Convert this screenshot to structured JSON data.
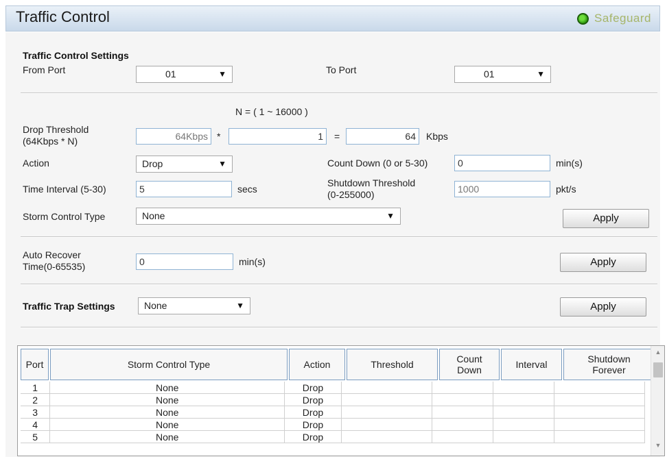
{
  "header": {
    "title": "Traffic Control",
    "badge": "Safeguard"
  },
  "settings": {
    "heading": "Traffic Control Settings",
    "from_port_label": "From Port",
    "from_port": "01",
    "to_port_label": "To Port",
    "to_port": "01",
    "n_range": "N = ( 1 ~ 16000 )",
    "drop_threshold_label_1": "Drop Threshold",
    "drop_threshold_label_2": "(64Kbps * N)",
    "base_value": "64Kbps",
    "mult_symbol": "*",
    "n_value": "1",
    "eq_symbol": "=",
    "result_value": "64",
    "result_unit": "Kbps",
    "action_label": "Action",
    "action_value": "Drop",
    "countdown_label": "Count Down (0 or 5-30)",
    "countdown_value": "0",
    "countdown_unit": "min(s)",
    "interval_label": "Time Interval (5-30)",
    "interval_value": "5",
    "interval_unit": "secs",
    "shutdown_label_1": "Shutdown Threshold",
    "shutdown_label_2": "(0-255000)",
    "shutdown_value": "1000",
    "shutdown_unit": "pkt/s",
    "storm_type_label": "Storm Control Type",
    "storm_type_value": "None",
    "apply": "Apply"
  },
  "auto_recover": {
    "label_1": "Auto Recover",
    "label_2": "Time(0-65535)",
    "value": "0",
    "unit": "min(s)",
    "apply": "Apply"
  },
  "trap": {
    "label": "Traffic Trap Settings",
    "value": "None",
    "apply": "Apply"
  },
  "table": {
    "headers": [
      "Port",
      "Storm Control Type",
      "Action",
      "Threshold",
      "Count Down",
      "Interval",
      "Shutdown Forever"
    ],
    "rows": [
      [
        "1",
        "None",
        "Drop",
        "",
        "",
        "",
        ""
      ],
      [
        "2",
        "None",
        "Drop",
        "",
        "",
        "",
        ""
      ],
      [
        "3",
        "None",
        "Drop",
        "",
        "",
        "",
        ""
      ],
      [
        "4",
        "None",
        "Drop",
        "",
        "",
        "",
        ""
      ],
      [
        "5",
        "None",
        "Drop",
        "",
        "",
        "",
        ""
      ]
    ]
  },
  "icons": {
    "dropdown": "chevron-down-icon",
    "status": "green-status-icon"
  }
}
